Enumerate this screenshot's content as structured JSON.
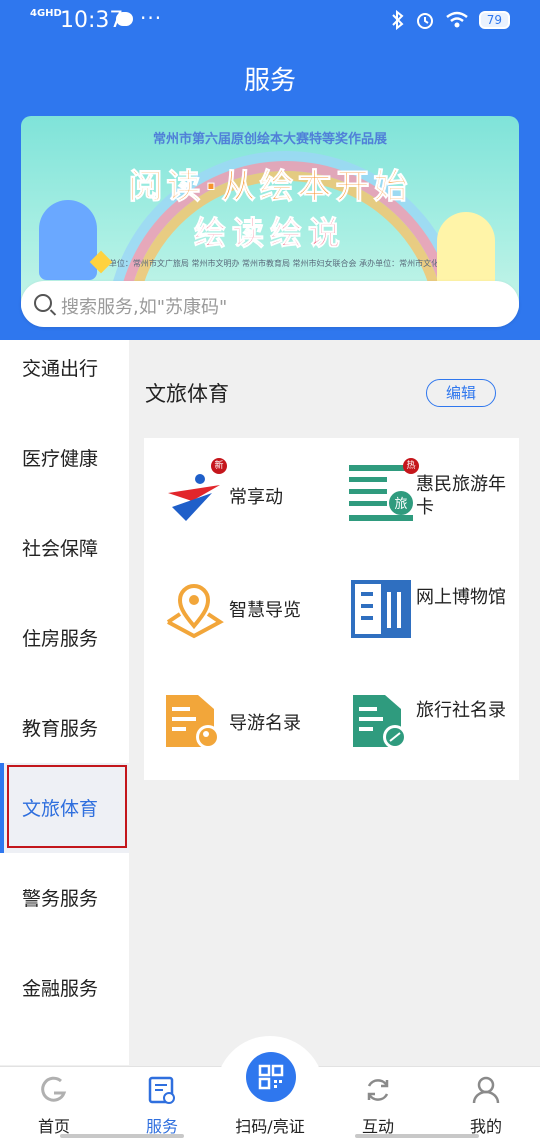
{
  "status": {
    "network": "4GHD",
    "time": "10:37",
    "battery": "79"
  },
  "header": {
    "title": "服务"
  },
  "banner": {
    "top_text": "常州市第六届原创绘本大赛特等奖作品展",
    "headline": "阅读·从绘本开始",
    "subheadline": "绘读绘说",
    "credits": "主办单位：常州市文广旅局 常州市文明办 常州市教育局 常州市妇女联合会 承办单位：常州市文化馆"
  },
  "search": {
    "placeholder": "搜索服务,如\"苏康码\""
  },
  "sidebar": {
    "items": [
      {
        "label": "交通出行"
      },
      {
        "label": "医疗健康"
      },
      {
        "label": "社会保障"
      },
      {
        "label": "住房服务"
      },
      {
        "label": "教育服务"
      },
      {
        "label": "文旅体育"
      },
      {
        "label": "警务服务"
      },
      {
        "label": "金融服务"
      }
    ],
    "active_index": 5
  },
  "section": {
    "title": "文旅体育",
    "edit_label": "编辑",
    "tiles": [
      {
        "label": "常享动",
        "badge": "新",
        "icon": "changxiangdong-logo-icon"
      },
      {
        "label": "惠民旅游年卡",
        "badge": "热",
        "icon": "travel-card-icon"
      },
      {
        "label": "智慧导览",
        "icon": "map-pin-icon"
      },
      {
        "label": "网上博物馆",
        "icon": "museum-building-icon"
      },
      {
        "label": "导游名录",
        "icon": "guide-folder-icon"
      },
      {
        "label": "旅行社名录",
        "icon": "agency-folder-icon"
      }
    ]
  },
  "tabbar": {
    "tabs": [
      {
        "label": "首页",
        "icon": "home-logo-icon"
      },
      {
        "label": "服务",
        "icon": "service-doc-icon"
      },
      {
        "label": "扫码/亮证",
        "icon": "qr-scan-icon"
      },
      {
        "label": "互动",
        "icon": "refresh-icon"
      },
      {
        "label": "我的",
        "icon": "user-icon"
      }
    ],
    "active_index": 1
  },
  "colors": {
    "primary": "#2f77ee",
    "badge_red": "#c5161c",
    "orange": "#f2a63a",
    "teal": "#2f9b7e"
  }
}
